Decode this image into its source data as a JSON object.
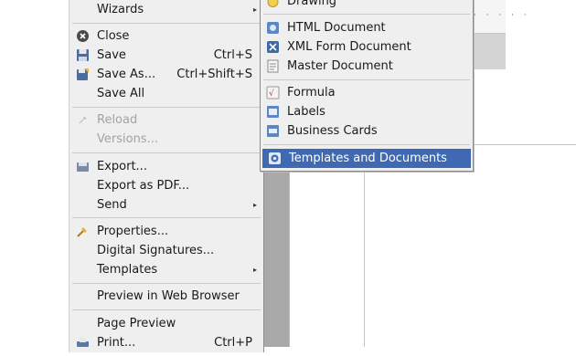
{
  "file_menu": {
    "items": [
      {
        "label": "Wizards",
        "shortcut": ""
      },
      {
        "label": "Close",
        "shortcut": ""
      },
      {
        "label": "Save",
        "shortcut": "Ctrl+S"
      },
      {
        "label": "Save As...",
        "shortcut": "Ctrl+Shift+S"
      },
      {
        "label": "Save All",
        "shortcut": ""
      },
      {
        "label": "Reload",
        "shortcut": ""
      },
      {
        "label": "Versions...",
        "shortcut": ""
      },
      {
        "label": "Export...",
        "shortcut": ""
      },
      {
        "label": "Export as PDF...",
        "shortcut": ""
      },
      {
        "label": "Send",
        "shortcut": ""
      },
      {
        "label": "Properties...",
        "shortcut": ""
      },
      {
        "label": "Digital Signatures...",
        "shortcut": ""
      },
      {
        "label": "Templates",
        "shortcut": ""
      },
      {
        "label": "Preview in Web Browser",
        "shortcut": ""
      },
      {
        "label": "Page Preview",
        "shortcut": ""
      },
      {
        "label": "Print...",
        "shortcut": "Ctrl+P"
      }
    ]
  },
  "new_submenu": {
    "items": [
      {
        "label": "Drawing"
      },
      {
        "label": "HTML Document"
      },
      {
        "label": "XML Form Document"
      },
      {
        "label": "Master Document"
      },
      {
        "label": "Formula"
      },
      {
        "label": "Labels"
      },
      {
        "label": "Business Cards"
      },
      {
        "label": "Templates and Documents"
      }
    ]
  },
  "colors": {
    "menu_bg": "#efefef",
    "highlight": "#3f6ab3",
    "disabled_text": "#a3a3a3"
  },
  "icons": [
    "close-icon",
    "save-icon",
    "save-as-icon",
    "reload-icon",
    "export-icon",
    "properties-icon",
    "print-icon",
    "drawing-icon",
    "html-document-icon",
    "xml-form-icon",
    "master-document-icon",
    "formula-icon",
    "labels-icon",
    "business-cards-icon",
    "templates-documents-icon"
  ]
}
